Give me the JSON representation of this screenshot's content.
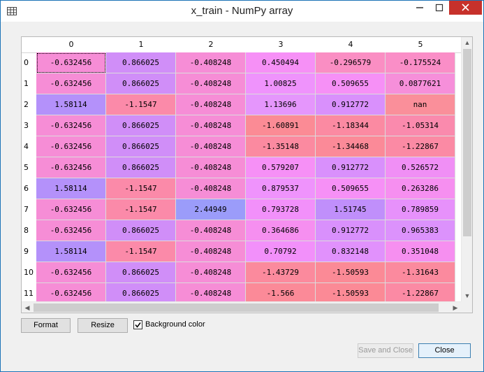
{
  "window": {
    "title": "x_train - NumPy array",
    "close_color": "#c7312b"
  },
  "table": {
    "columns": [
      "0",
      "1",
      "2",
      "3",
      "4",
      "5"
    ],
    "rows": [
      "0",
      "1",
      "2",
      "3",
      "4",
      "5",
      "6",
      "7",
      "8",
      "9",
      "10",
      "11"
    ],
    "cells": [
      [
        "-0.632456",
        "0.866025",
        "-0.408248",
        "0.450494",
        "-0.296579",
        "-0.175524"
      ],
      [
        "-0.632456",
        "0.866025",
        "-0.408248",
        "1.00825",
        "0.509655",
        "0.0877621"
      ],
      [
        "1.58114",
        "-1.1547",
        "-0.408248",
        "1.13696",
        "0.912772",
        "nan"
      ],
      [
        "-0.632456",
        "0.866025",
        "-0.408248",
        "-1.60891",
        "-1.18344",
        "-1.05314"
      ],
      [
        "-0.632456",
        "0.866025",
        "-0.408248",
        "-1.35148",
        "-1.34468",
        "-1.22867"
      ],
      [
        "-0.632456",
        "0.866025",
        "-0.408248",
        "0.579207",
        "0.912772",
        "0.526572"
      ],
      [
        "1.58114",
        "-1.1547",
        "-0.408248",
        "0.879537",
        "0.509655",
        "0.263286"
      ],
      [
        "-0.632456",
        "-1.1547",
        "2.44949",
        "0.793728",
        "1.51745",
        "0.789859"
      ],
      [
        "-0.632456",
        "0.866025",
        "-0.408248",
        "0.364686",
        "0.912772",
        "0.965383"
      ],
      [
        "1.58114",
        "-1.1547",
        "-0.408248",
        "0.70792",
        "0.832148",
        "0.351048"
      ],
      [
        "-0.632456",
        "0.866025",
        "-0.408248",
        "-1.43729",
        "-1.50593",
        "-1.31643"
      ],
      [
        "-0.632456",
        "0.866025",
        "-0.408248",
        "-1.566",
        "-1.50593",
        "-1.22867"
      ]
    ],
    "colors": [
      [
        "#f68dd6",
        "#d08ef8",
        "#f68dd6",
        "#f690f6",
        "#fa8ec3",
        "#fa8ec7"
      ],
      [
        "#f68dd6",
        "#d08ef8",
        "#f68dd6",
        "#ef93fc",
        "#f690f6",
        "#f68fda"
      ],
      [
        "#b491fa",
        "#fb8aa9",
        "#f68dd6",
        "#e596fc",
        "#d990fc",
        "#fa8f9a"
      ],
      [
        "#f68dd6",
        "#d08ef8",
        "#f68dd6",
        "#fb8b95",
        "#fb8aa2",
        "#fa8aad"
      ],
      [
        "#f68dd6",
        "#d08ef8",
        "#f68dd6",
        "#fb8aa0",
        "#fb8a98",
        "#fb8aa4"
      ],
      [
        "#f68dd6",
        "#d08ef8",
        "#f68dd6",
        "#f690f6",
        "#d990fc",
        "#f08ff5"
      ],
      [
        "#b491fa",
        "#fb8aa9",
        "#f68dd6",
        "#ef93fc",
        "#f690f6",
        "#f68ff0"
      ],
      [
        "#f68dd6",
        "#fb8aa9",
        "#9b9cfa",
        "#f290fa",
        "#c08ffb",
        "#e791fb"
      ],
      [
        "#f68dd6",
        "#d08ef8",
        "#f68dd6",
        "#f68ff0",
        "#d990fc",
        "#dc92fc"
      ],
      [
        "#b491fa",
        "#fb8aa9",
        "#f68dd6",
        "#f290fa",
        "#e191fc",
        "#f68ff0"
      ],
      [
        "#f68dd6",
        "#d08ef8",
        "#f68dd6",
        "#fb8a9d",
        "#fb8a96",
        "#fb8a9e"
      ],
      [
        "#f68dd6",
        "#d08ef8",
        "#f68dd6",
        "#fb8a98",
        "#fb8a96",
        "#fb8aa4"
      ]
    ],
    "selected_cell": "0,0"
  },
  "buttons": {
    "format": "Format",
    "resize": "Resize",
    "save_close": "Save and Close",
    "close": "Close"
  },
  "options": {
    "background_color_label": "Background color",
    "background_color_checked": true
  },
  "scroll": {
    "up": "▲",
    "down": "▼",
    "left": "◀",
    "right": "▶"
  }
}
